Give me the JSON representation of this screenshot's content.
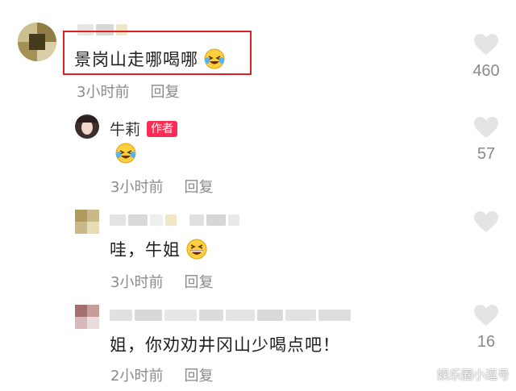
{
  "comments": [
    {
      "text": "景岗山走哪喝哪",
      "time": "3小时前",
      "reply_label": "回复",
      "likes": "460",
      "emoji": "laughing-tears-icon"
    },
    {
      "author": "牛莉",
      "author_badge": "作者",
      "text": "",
      "time": "3小时前",
      "reply_label": "回复",
      "likes": "57",
      "emoji": "laughing-tears-icon"
    },
    {
      "text": "哇，牛姐",
      "time": "3小时前",
      "reply_label": "回复",
      "likes": "",
      "emoji": "grinning-laugh-icon"
    },
    {
      "text": "姐，你劝劝井冈山少喝点吧！",
      "time": "2小时前",
      "reply_label": "回复",
      "likes": "16"
    }
  ],
  "watermark": "娱乐圈小逗号",
  "colors": {
    "highlight": "#e02020",
    "badge": "#fe2c55",
    "meta_text": "#8a8a8a",
    "heart": "#e4e4e4"
  }
}
